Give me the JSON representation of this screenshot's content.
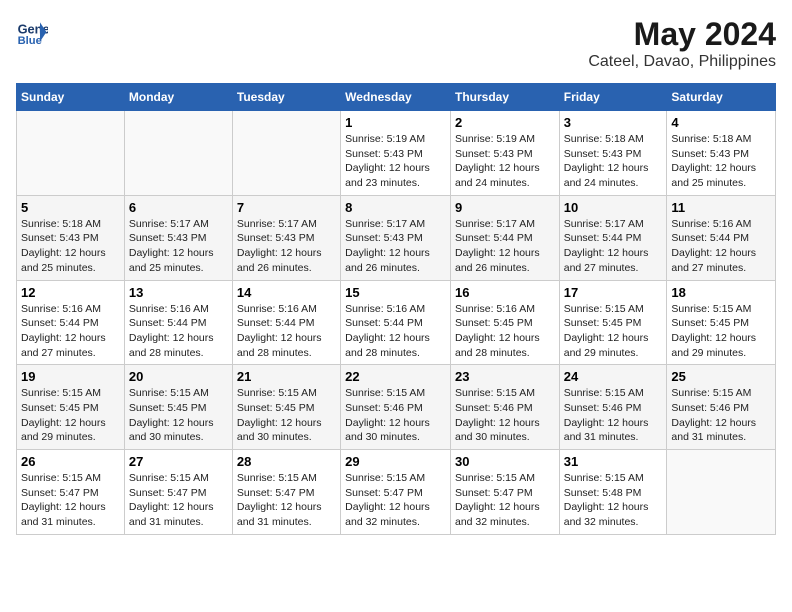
{
  "header": {
    "logo_line1": "General",
    "logo_line2": "Blue",
    "title": "May 2024",
    "subtitle": "Cateel, Davao, Philippines"
  },
  "days_of_week": [
    "Sunday",
    "Monday",
    "Tuesday",
    "Wednesday",
    "Thursday",
    "Friday",
    "Saturday"
  ],
  "weeks": [
    [
      {
        "day": "",
        "info": ""
      },
      {
        "day": "",
        "info": ""
      },
      {
        "day": "",
        "info": ""
      },
      {
        "day": "1",
        "info": "Sunrise: 5:19 AM\nSunset: 5:43 PM\nDaylight: 12 hours\nand 23 minutes."
      },
      {
        "day": "2",
        "info": "Sunrise: 5:19 AM\nSunset: 5:43 PM\nDaylight: 12 hours\nand 24 minutes."
      },
      {
        "day": "3",
        "info": "Sunrise: 5:18 AM\nSunset: 5:43 PM\nDaylight: 12 hours\nand 24 minutes."
      },
      {
        "day": "4",
        "info": "Sunrise: 5:18 AM\nSunset: 5:43 PM\nDaylight: 12 hours\nand 25 minutes."
      }
    ],
    [
      {
        "day": "5",
        "info": "Sunrise: 5:18 AM\nSunset: 5:43 PM\nDaylight: 12 hours\nand 25 minutes."
      },
      {
        "day": "6",
        "info": "Sunrise: 5:17 AM\nSunset: 5:43 PM\nDaylight: 12 hours\nand 25 minutes."
      },
      {
        "day": "7",
        "info": "Sunrise: 5:17 AM\nSunset: 5:43 PM\nDaylight: 12 hours\nand 26 minutes."
      },
      {
        "day": "8",
        "info": "Sunrise: 5:17 AM\nSunset: 5:43 PM\nDaylight: 12 hours\nand 26 minutes."
      },
      {
        "day": "9",
        "info": "Sunrise: 5:17 AM\nSunset: 5:44 PM\nDaylight: 12 hours\nand 26 minutes."
      },
      {
        "day": "10",
        "info": "Sunrise: 5:17 AM\nSunset: 5:44 PM\nDaylight: 12 hours\nand 27 minutes."
      },
      {
        "day": "11",
        "info": "Sunrise: 5:16 AM\nSunset: 5:44 PM\nDaylight: 12 hours\nand 27 minutes."
      }
    ],
    [
      {
        "day": "12",
        "info": "Sunrise: 5:16 AM\nSunset: 5:44 PM\nDaylight: 12 hours\nand 27 minutes."
      },
      {
        "day": "13",
        "info": "Sunrise: 5:16 AM\nSunset: 5:44 PM\nDaylight: 12 hours\nand 28 minutes."
      },
      {
        "day": "14",
        "info": "Sunrise: 5:16 AM\nSunset: 5:44 PM\nDaylight: 12 hours\nand 28 minutes."
      },
      {
        "day": "15",
        "info": "Sunrise: 5:16 AM\nSunset: 5:44 PM\nDaylight: 12 hours\nand 28 minutes."
      },
      {
        "day": "16",
        "info": "Sunrise: 5:16 AM\nSunset: 5:45 PM\nDaylight: 12 hours\nand 28 minutes."
      },
      {
        "day": "17",
        "info": "Sunrise: 5:15 AM\nSunset: 5:45 PM\nDaylight: 12 hours\nand 29 minutes."
      },
      {
        "day": "18",
        "info": "Sunrise: 5:15 AM\nSunset: 5:45 PM\nDaylight: 12 hours\nand 29 minutes."
      }
    ],
    [
      {
        "day": "19",
        "info": "Sunrise: 5:15 AM\nSunset: 5:45 PM\nDaylight: 12 hours\nand 29 minutes."
      },
      {
        "day": "20",
        "info": "Sunrise: 5:15 AM\nSunset: 5:45 PM\nDaylight: 12 hours\nand 30 minutes."
      },
      {
        "day": "21",
        "info": "Sunrise: 5:15 AM\nSunset: 5:45 PM\nDaylight: 12 hours\nand 30 minutes."
      },
      {
        "day": "22",
        "info": "Sunrise: 5:15 AM\nSunset: 5:46 PM\nDaylight: 12 hours\nand 30 minutes."
      },
      {
        "day": "23",
        "info": "Sunrise: 5:15 AM\nSunset: 5:46 PM\nDaylight: 12 hours\nand 30 minutes."
      },
      {
        "day": "24",
        "info": "Sunrise: 5:15 AM\nSunset: 5:46 PM\nDaylight: 12 hours\nand 31 minutes."
      },
      {
        "day": "25",
        "info": "Sunrise: 5:15 AM\nSunset: 5:46 PM\nDaylight: 12 hours\nand 31 minutes."
      }
    ],
    [
      {
        "day": "26",
        "info": "Sunrise: 5:15 AM\nSunset: 5:47 PM\nDaylight: 12 hours\nand 31 minutes."
      },
      {
        "day": "27",
        "info": "Sunrise: 5:15 AM\nSunset: 5:47 PM\nDaylight: 12 hours\nand 31 minutes."
      },
      {
        "day": "28",
        "info": "Sunrise: 5:15 AM\nSunset: 5:47 PM\nDaylight: 12 hours\nand 31 minutes."
      },
      {
        "day": "29",
        "info": "Sunrise: 5:15 AM\nSunset: 5:47 PM\nDaylight: 12 hours\nand 32 minutes."
      },
      {
        "day": "30",
        "info": "Sunrise: 5:15 AM\nSunset: 5:47 PM\nDaylight: 12 hours\nand 32 minutes."
      },
      {
        "day": "31",
        "info": "Sunrise: 5:15 AM\nSunset: 5:48 PM\nDaylight: 12 hours\nand 32 minutes."
      },
      {
        "day": "",
        "info": ""
      }
    ]
  ]
}
